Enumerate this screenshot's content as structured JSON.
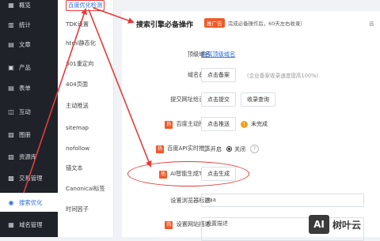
{
  "sidebar": {
    "items": [
      {
        "label": "概览",
        "icon": "grid-icon"
      },
      {
        "label": "统计",
        "icon": "chart-icon"
      },
      {
        "label": "文章",
        "icon": "document-icon"
      },
      {
        "label": "产品",
        "icon": "box-icon"
      },
      {
        "label": "表单",
        "icon": "form-icon"
      },
      {
        "label": "互动",
        "icon": "chat-icon"
      },
      {
        "label": "图册",
        "icon": "image-icon"
      },
      {
        "label": "资源库",
        "icon": "folder-icon"
      },
      {
        "label": "交易管理",
        "icon": "cart-icon"
      },
      {
        "label": "搜索优化",
        "icon": "search-icon",
        "active": true
      },
      {
        "label": "域名管理",
        "icon": "globe-icon"
      }
    ]
  },
  "submenu": {
    "items": [
      {
        "label": "百度优化检测",
        "active": true
      },
      {
        "label": "TDK设置"
      },
      {
        "label": "html静态化"
      },
      {
        "label": "301重定向"
      },
      {
        "label": "404页面"
      },
      {
        "label": "主动推送"
      },
      {
        "label": "sitemap"
      },
      {
        "label": "nofollow"
      },
      {
        "label": "锚文本"
      },
      {
        "label": "Canonical标签"
      },
      {
        "label": "时间因子"
      }
    ]
  },
  "panel": {
    "title": "搜索引擎必备操作",
    "badge": "推广告",
    "hint": "完成必备操作后，60天左右收录）",
    "hint_right": "选"
  },
  "rows": {
    "top_domain_label": "顶级域名:",
    "top_domain_link": "购买顶级域名",
    "record_label": "域名备案:",
    "record_button": "点击备案",
    "record_note": "(企业备案收录速度提高100%)",
    "submit_label": "提交网址给百度:",
    "submit_button": "点击提交",
    "query_button": "收录查询",
    "push_hot": "热",
    "push_label": "百度主动推送:",
    "push_button": "点击推送",
    "push_status": "未完成",
    "api_hot": "热",
    "api_label": "百度API实时推送:",
    "api_on": "开启",
    "api_off": "关闭",
    "api_help": "?",
    "ai_hot": "热",
    "ai_label": "AI智能生成TDK:",
    "ai_button": "点击生成",
    "browser_title_label": "设置浏览器标题:",
    "browser_title_value": "aaa",
    "desc_hot": "热",
    "desc_label": "设置网站描述:",
    "desc_value": "设置描述"
  },
  "watermark": {
    "logo": "AI",
    "text": "树叶云"
  },
  "colors": {
    "sidebar_bg": "#1f2329",
    "accent": "#2f6fdc",
    "annotation_red": "#e23c39",
    "hot_orange": "#f05a28"
  }
}
